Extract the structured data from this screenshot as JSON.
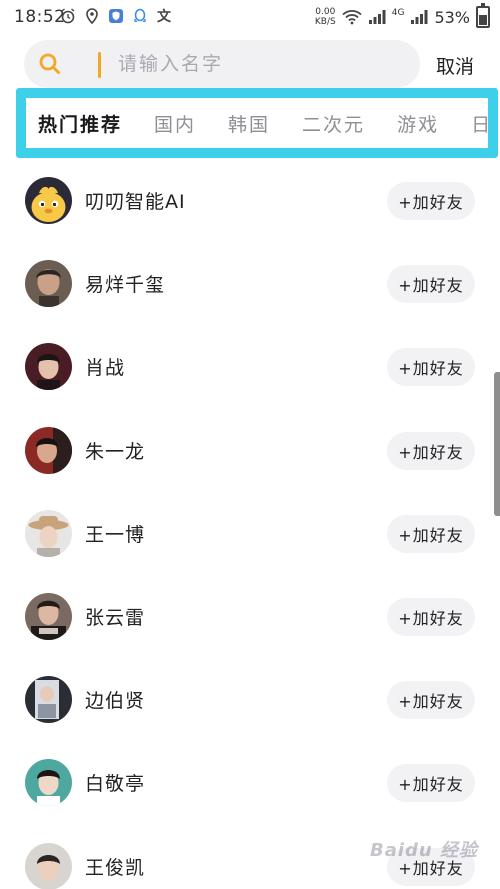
{
  "status_bar": {
    "time": "18:52",
    "net_speed_value": "0.00",
    "net_speed_unit": "KB/S",
    "network_type": "4G",
    "battery_text": "53%",
    "text_icon_glyph": "文"
  },
  "search": {
    "placeholder": "请输入名字",
    "value": "",
    "cancel_label": "取消"
  },
  "tabs": [
    {
      "label": "热门推荐",
      "active": true
    },
    {
      "label": "国内",
      "active": false
    },
    {
      "label": "韩国",
      "active": false
    },
    {
      "label": "二次元",
      "active": false
    },
    {
      "label": "游戏",
      "active": false
    },
    {
      "label": "日本",
      "active": false
    }
  ],
  "contacts": [
    {
      "name": "叨叨智能AI",
      "button": "+加好友",
      "avatar": "duck-avatar"
    },
    {
      "name": "易烊千玺",
      "button": "+加好友",
      "avatar": "portrait-avatar"
    },
    {
      "name": "肖战",
      "button": "+加好友",
      "avatar": "portrait-avatar"
    },
    {
      "name": "朱一龙",
      "button": "+加好友",
      "avatar": "portrait-avatar"
    },
    {
      "name": "王一博",
      "button": "+加好友",
      "avatar": "portrait-avatar"
    },
    {
      "name": "张云雷",
      "button": "+加好友",
      "avatar": "portrait-avatar"
    },
    {
      "name": "边伯贤",
      "button": "+加好友",
      "avatar": "portrait-avatar"
    },
    {
      "name": "白敬亭",
      "button": "+加好友",
      "avatar": "portrait-avatar"
    },
    {
      "name": "王俊凯",
      "button": "+加好友",
      "avatar": "portrait-avatar"
    }
  ],
  "watermark": "Baidu 经验",
  "colors": {
    "accent": "#f5a623",
    "tab_highlight": "#3dd0e8",
    "button_bg": "#f2f2f4",
    "search_bg": "#f1f1f4"
  }
}
